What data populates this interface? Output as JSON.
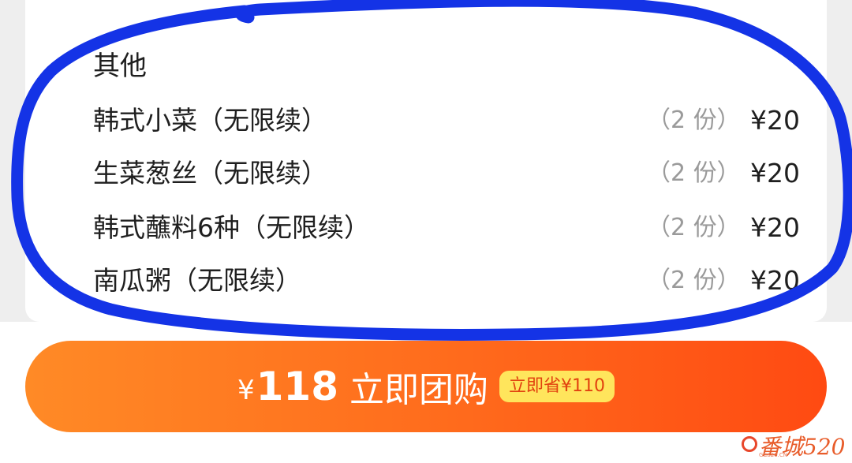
{
  "section": {
    "title": "其他"
  },
  "items": [
    {
      "name": "韩式小菜（无限续）",
      "qty": "（2 份）",
      "price": "¥20"
    },
    {
      "name": "生菜葱丝（无限续）",
      "qty": "（2 份）",
      "price": "¥20"
    },
    {
      "name": "韩式蘸料6种（无限续）",
      "qty": "（2 份）",
      "price": "¥20"
    },
    {
      "name": "南瓜粥（无限续）",
      "qty": "（2 份）",
      "price": "¥20"
    }
  ],
  "buy_button": {
    "currency": "¥",
    "amount": "118",
    "label": "立即团购",
    "badge": "立即省¥110"
  },
  "watermark": {
    "text": "番城520",
    "sub": "GCS20.CN"
  },
  "colors": {
    "button_start": "#ff8a26",
    "button_end": "#ff4a12",
    "badge_bg": "#ffe55c",
    "annotation": "#1433e6"
  }
}
